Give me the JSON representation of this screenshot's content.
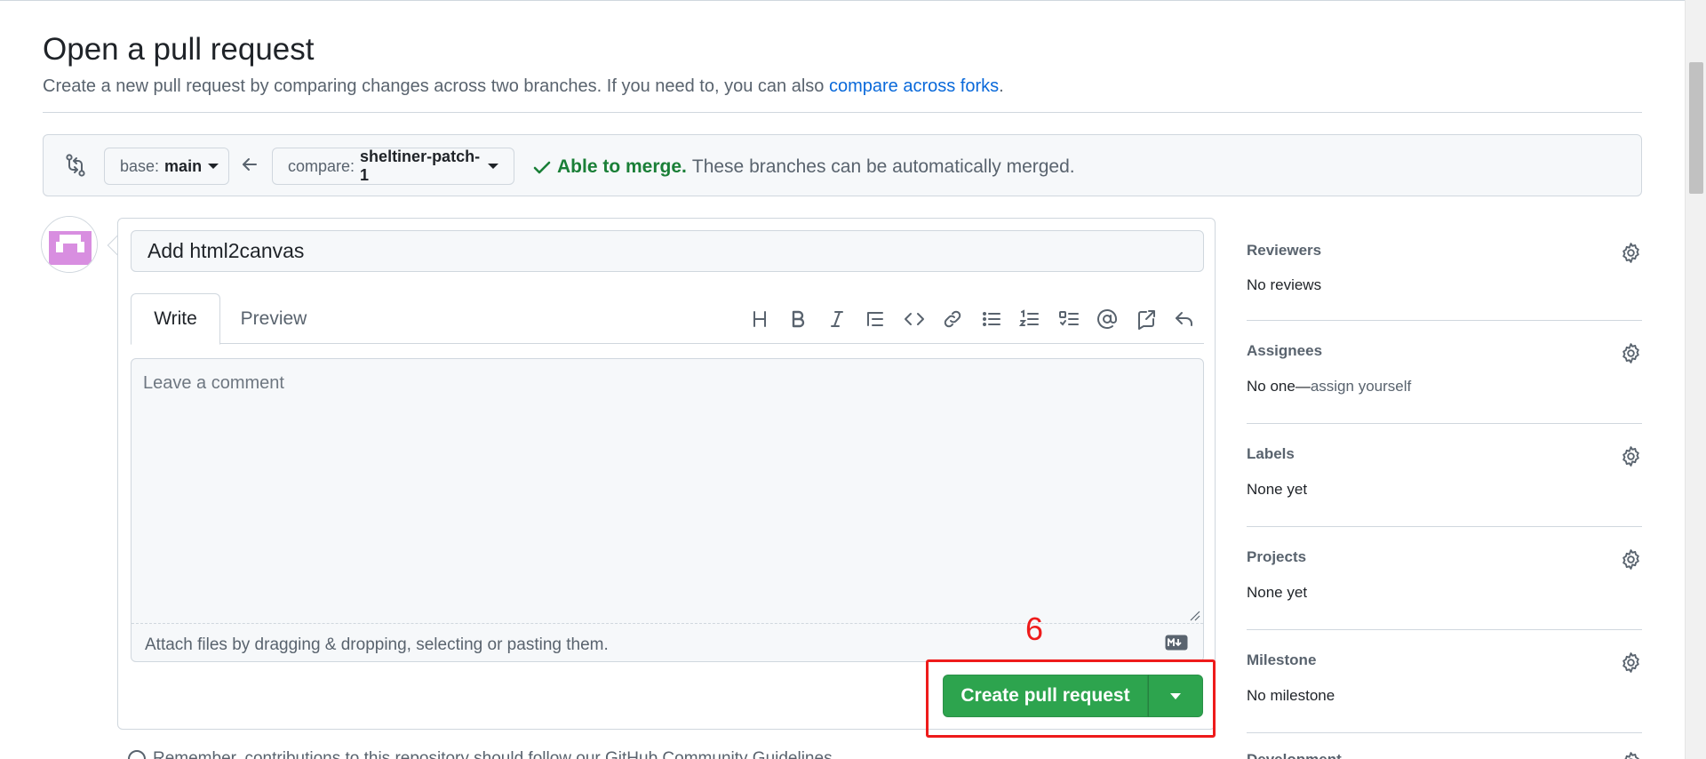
{
  "page": {
    "title": "Open a pull request",
    "subtitle_text": "Create a new pull request by comparing changes across two branches. If you need to, you can also",
    "subtitle_link": "compare across forks",
    "subtitle_end": "."
  },
  "range": {
    "base_prefix": "base:",
    "base_branch": "main",
    "compare_prefix": "compare:",
    "compare_branch": "sheltiner-patch-1",
    "merge_ok": "Able to merge.",
    "merge_desc": "These branches can be automatically merged."
  },
  "form": {
    "title_value": "Add html2canvas",
    "tabs": [
      "Write",
      "Preview"
    ],
    "comment_placeholder": "Leave a comment",
    "attach_hint": "Attach files by dragging & dropping, selecting or pasting them.",
    "toolbar_icons": [
      "heading-icon",
      "bold-icon",
      "italic-icon",
      "quote-icon",
      "code-icon",
      "link-icon",
      "unordered-list-icon",
      "ordered-list-icon",
      "task-list-icon",
      "mention-icon",
      "cross-reference-icon",
      "reply-icon"
    ],
    "submit_label": "Create pull request"
  },
  "annotation": {
    "number": "6",
    "color": "#ee1b1b"
  },
  "footnote": {
    "text": "Remember, contributions to this repository should follow our GitHub Community Guidelines."
  },
  "sidebar": {
    "reviewers": {
      "heading": "Reviewers",
      "value": "No reviews"
    },
    "assignees": {
      "heading": "Assignees",
      "value": "No one—",
      "action": "assign yourself"
    },
    "labels": {
      "heading": "Labels",
      "value": "None yet"
    },
    "projects": {
      "heading": "Projects",
      "value": "None yet"
    },
    "milestone": {
      "heading": "Milestone",
      "value": "No milestone"
    },
    "development": {
      "heading": "Development"
    }
  },
  "colors": {
    "accent_link": "#0969da",
    "success": "#1a7f37",
    "primary_button": "#2da44e",
    "avatar": "#d88ee0"
  }
}
